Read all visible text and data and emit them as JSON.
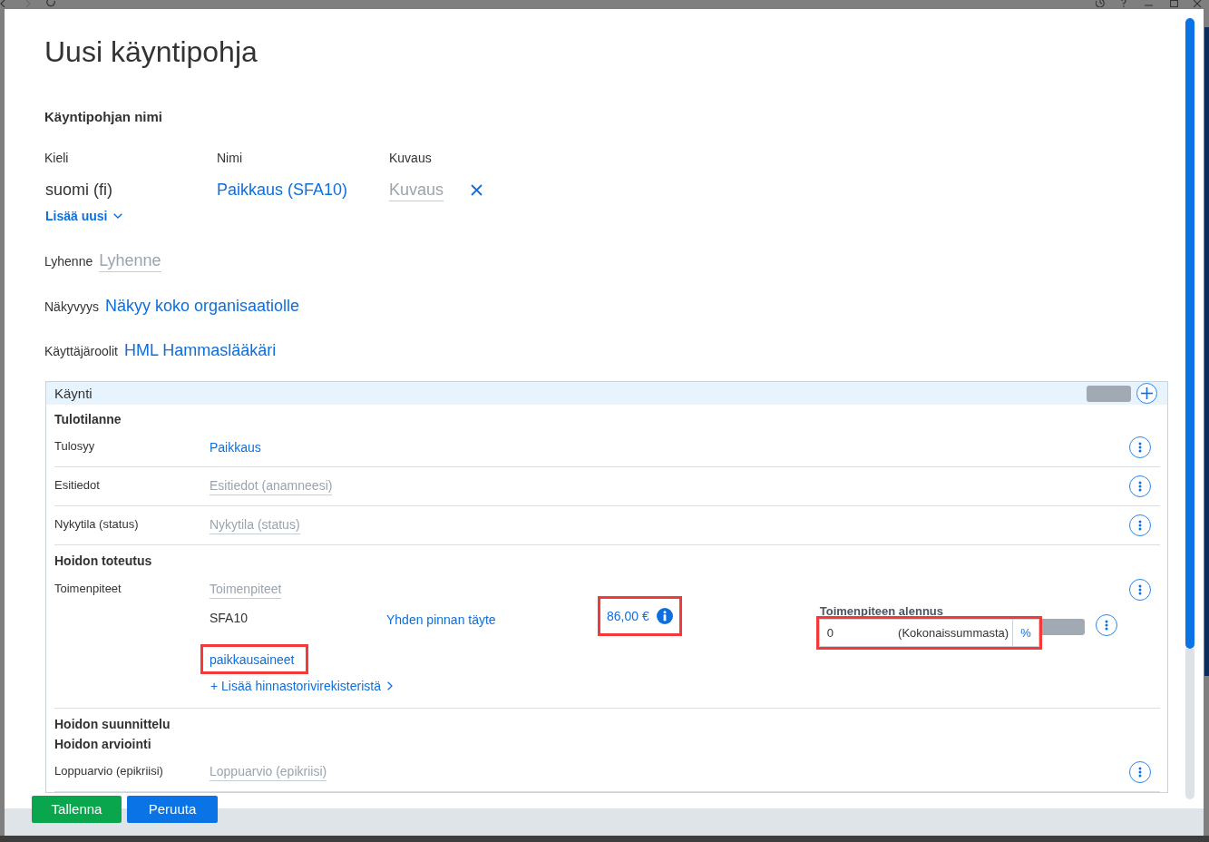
{
  "dialog": {
    "title": "Uusi käyntipohja"
  },
  "name_section": {
    "heading": "Käyntipohjan nimi",
    "columns": [
      "Kieli",
      "Nimi",
      "Kuvaus"
    ],
    "translations": [
      {
        "language": "suomi (fi)",
        "name": "Paikkaus (SFA10)",
        "description_placeholder": "Kuvaus"
      }
    ],
    "add_new": "Lisää uusi"
  },
  "fields": [
    {
      "kind": "input",
      "label": "Lyhenne",
      "placeholder": "Lyhenne"
    },
    {
      "kind": "link",
      "label": "Näkyvyys",
      "value": "Näkyy koko organisaatiolle"
    },
    {
      "kind": "link",
      "label": "Käyttäjäroolit",
      "value": "HML Hammaslääkäri"
    }
  ],
  "panel": {
    "title": "Käynti",
    "sections": [
      {
        "heading": "Tulotilanne",
        "rows": [
          {
            "kind": "value",
            "label": "Tulosyy",
            "value": "Paikkaus"
          },
          {
            "kind": "input",
            "label": "Esitiedot",
            "placeholder": "Esitiedot (anamneesi)"
          },
          {
            "kind": "input",
            "label": "Nykytila (status)",
            "placeholder": "Nykytila (status)"
          }
        ]
      },
      {
        "heading": "Hoidon toteutus",
        "rows": [
          {
            "kind": "procedures",
            "label": "Toimenpiteet",
            "placeholder": "Toimenpiteet",
            "items": [
              {
                "code": "SFA10",
                "name": "Yhden pinnan täyte",
                "price": "86,00 €",
                "price_highlighted": true,
                "discount": {
                  "label": "Toimenpiteen alennus",
                  "value": "0",
                  "basis": "(Kokonaissummasta)",
                  "unit": "%",
                  "highlighted": true
                }
              }
            ],
            "materials": {
              "text": "paikkausaineet",
              "highlighted": true
            },
            "add_link": "+ Lisää hinnastorivirekisteristä"
          }
        ]
      },
      {
        "heading": "Hoidon suunnittelu"
      },
      {
        "heading": "Hoidon arviointi",
        "rows": [
          {
            "kind": "input",
            "label": "Loppuarvio (epikriisi)",
            "placeholder": "Loppuarvio (epikriisi)"
          }
        ]
      }
    ]
  },
  "buttons": [
    {
      "label": "Tallenna",
      "kind": "primary"
    },
    {
      "label": "Peruuta",
      "kind": "secondary"
    }
  ]
}
